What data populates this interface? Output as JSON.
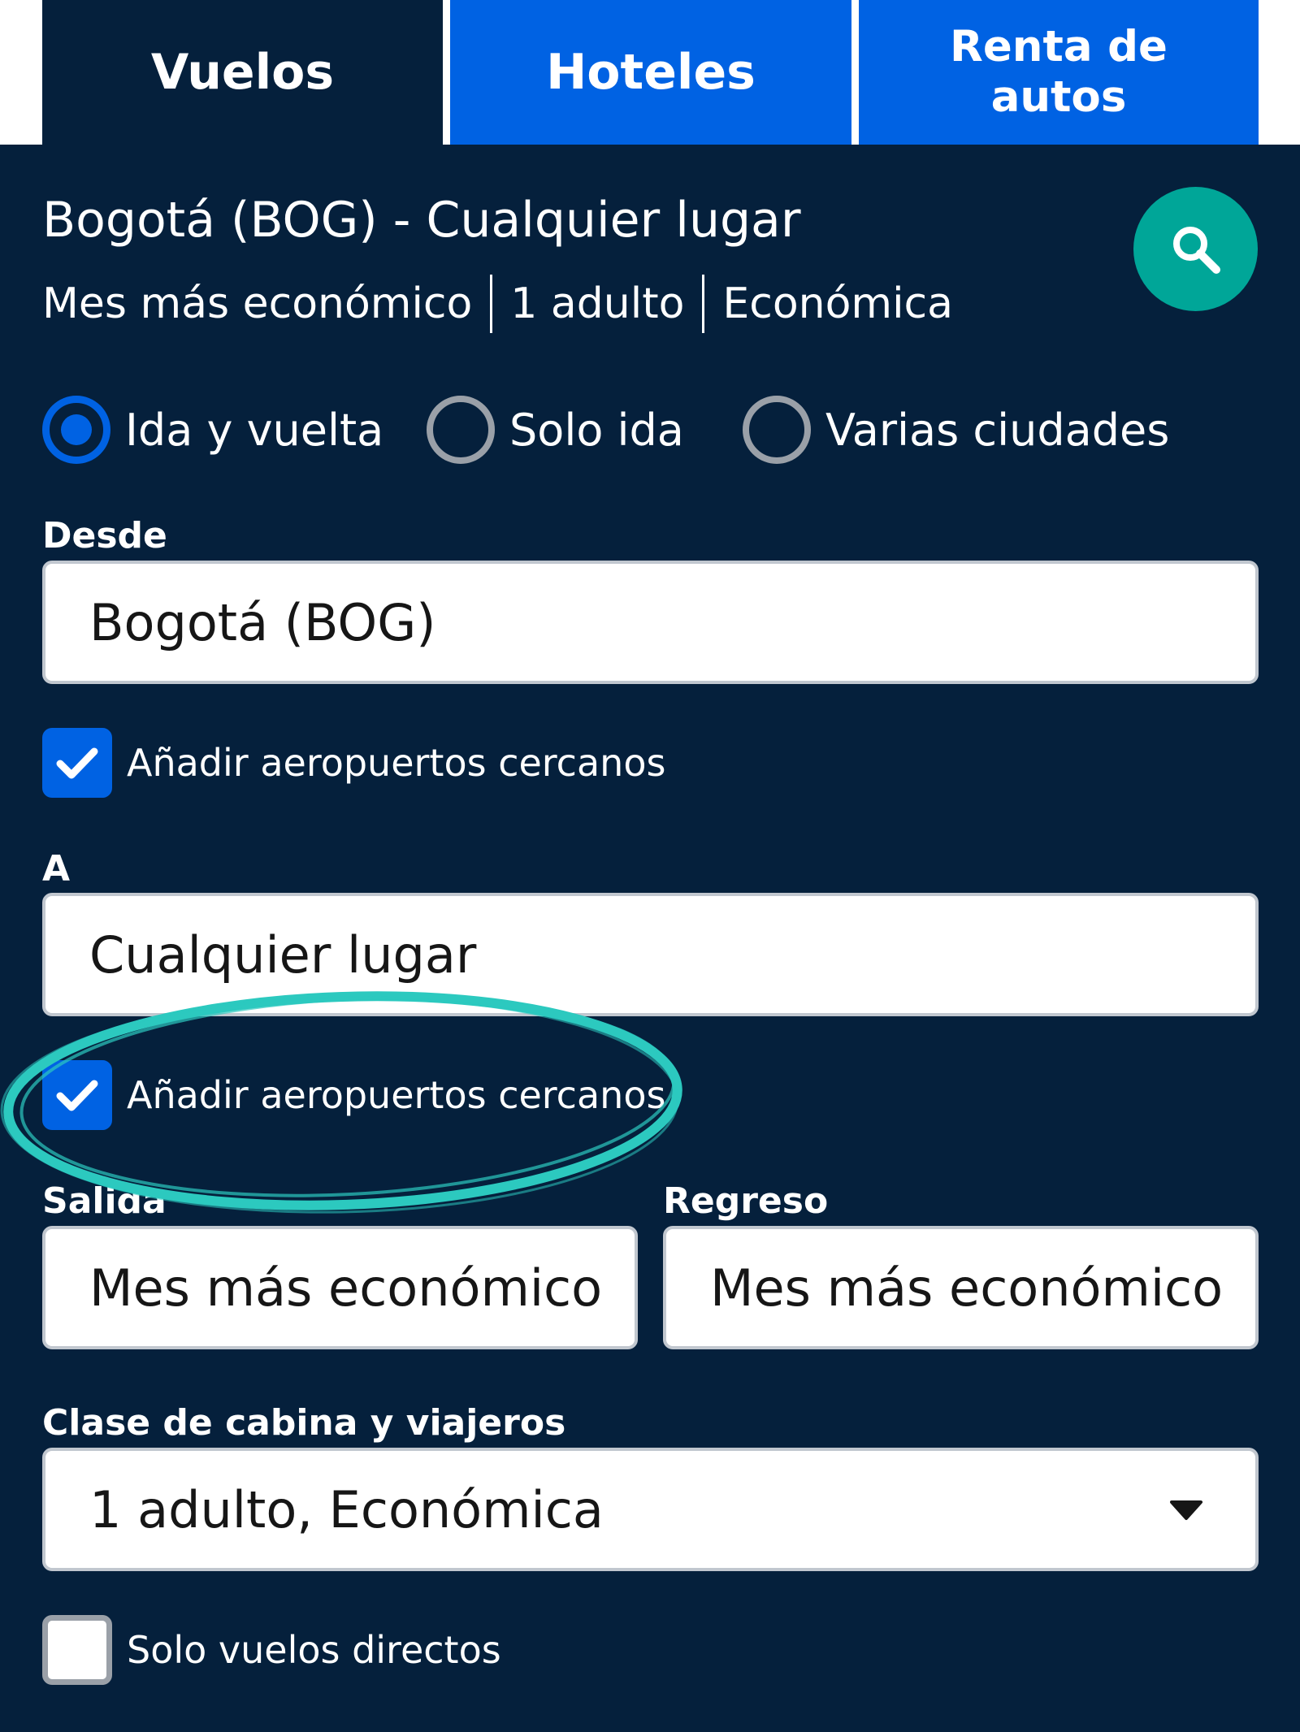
{
  "tabs": [
    {
      "label": "Vuelos"
    },
    {
      "label": "Hoteles"
    },
    {
      "label": "Renta de autos"
    }
  ],
  "summary": {
    "route": "Bogotá (BOG) - Cualquier lugar",
    "date": "Mes más económico",
    "travelers": "1 adulto",
    "cabin": "Económica"
  },
  "search_icon": "search-icon",
  "trip_type": {
    "options": [
      {
        "label": "Ida y vuelta",
        "selected": true
      },
      {
        "label": "Solo ida",
        "selected": false
      },
      {
        "label": "Varias ciudades",
        "selected": false
      }
    ]
  },
  "from": {
    "label": "Desde",
    "value": "Bogotá (BOG)",
    "nearby_label": "Añadir aeropuertos cercanos",
    "nearby_checked": true
  },
  "to": {
    "label": "A",
    "value": "Cualquier lugar",
    "nearby_label": "Añadir aeropuertos cercanos",
    "nearby_checked": true
  },
  "depart": {
    "label": "Salida",
    "value": "Mes más económico"
  },
  "return": {
    "label": "Regreso",
    "value": "Mes más económico"
  },
  "cabin": {
    "label": "Clase de cabina y viajeros",
    "value": "1 adulto, Económica"
  },
  "direct": {
    "label": "Solo vuelos directos",
    "checked": false
  },
  "colors": {
    "background": "#05203c",
    "tab_inactive": "#0062e3",
    "accent_blue": "#0062e3",
    "search_button": "#00a698",
    "highlight_stroke": "#2cc9bf"
  }
}
